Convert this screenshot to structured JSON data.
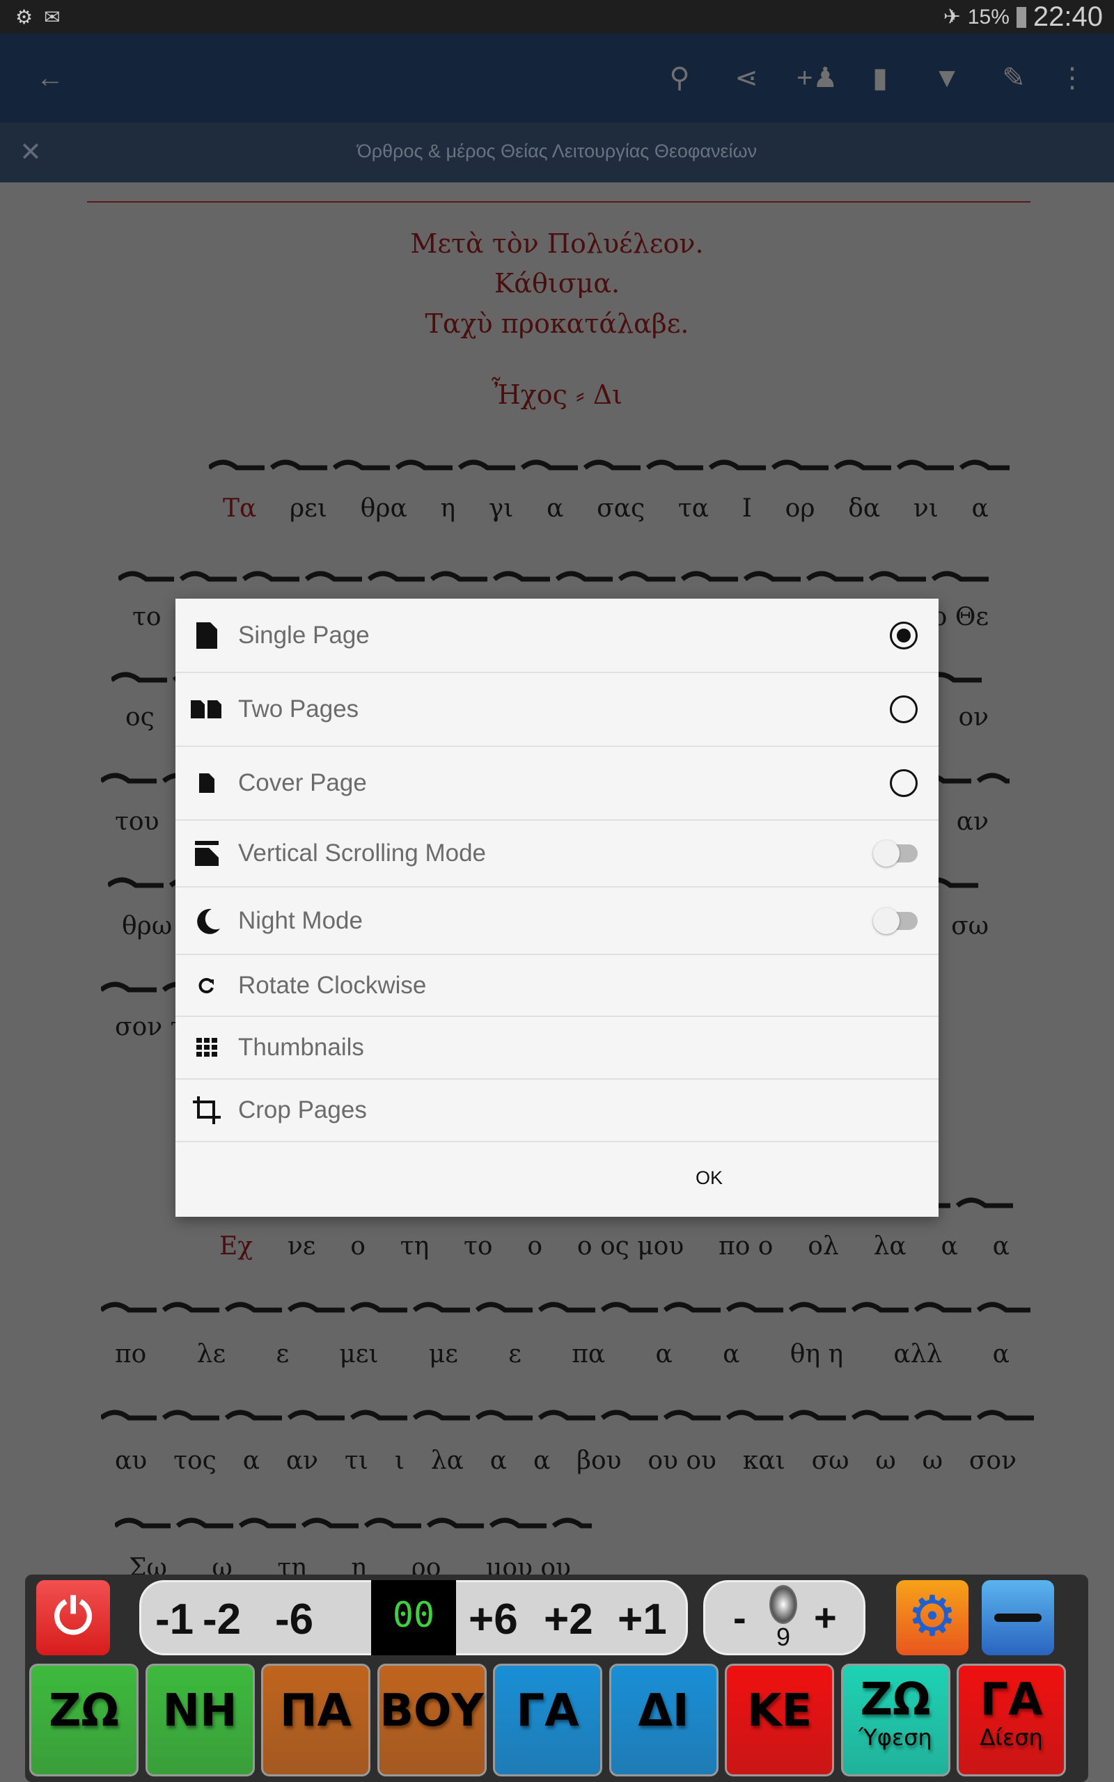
{
  "status_bar": {
    "battery": "15%",
    "time": "22:40",
    "icons": [
      "sd-settings-icon",
      "gmail-icon",
      "airplane-mode-icon",
      "battery-icon"
    ]
  },
  "toolbar": {
    "icons": [
      "back-arrow-icon",
      "search-icon",
      "share-icon",
      "add-person-icon",
      "page-icon",
      "bookmark-icon",
      "edit-icon",
      "more-vert-icon"
    ]
  },
  "subbar": {
    "title": "Όρθρος & μέρος Θείας Λειτουργίας Θεοφανείων"
  },
  "document": {
    "headings": [
      "Μετὰ τὸν Πολυέλεον.",
      "Κάθισμα.",
      "Ταχὺ προκατάλαβε."
    ],
    "echos": "Ἦχος",
    "echos_note": "Δι",
    "lines": [
      [
        "Τα",
        "ρει",
        "θρα",
        "η",
        "γι",
        "α",
        "σας",
        "τα",
        "Ι",
        "ορ",
        "δα",
        "νι",
        "α"
      ],
      [
        "το",
        "ο Θε"
      ],
      [
        "ος",
        "ον"
      ],
      [
        "του",
        "αν"
      ],
      [
        "θρω",
        "σω"
      ],
      [
        "σον τ"
      ],
      [
        "Εχ",
        "νε",
        "ο",
        "τη",
        "το",
        "ο",
        "ο ος μου",
        "πο ο",
        "ολ",
        "λα",
        "α",
        "α"
      ],
      [
        "πο",
        "λε",
        "ε",
        "μει",
        "με",
        "ε",
        "πα",
        "α",
        "α",
        "θη η",
        "αλλ",
        "α"
      ],
      [
        "αυ",
        "τος",
        "α",
        "αν",
        "τι",
        "ι",
        "λα",
        "α",
        "α",
        "βου",
        "ου ου",
        "και",
        "σω",
        "ω",
        "ω",
        "σον"
      ],
      [
        "Σω",
        "ω",
        "τη",
        "η",
        "ρο",
        "μου ου"
      ]
    ]
  },
  "dialog": {
    "items": [
      {
        "label": "Single Page",
        "icon": "single-page-icon",
        "control": "radio",
        "selected": true
      },
      {
        "label": "Two Pages",
        "icon": "two-pages-icon",
        "control": "radio",
        "selected": false
      },
      {
        "label": "Cover Page",
        "icon": "cover-page-icon",
        "control": "radio",
        "selected": false
      },
      {
        "label": "Vertical Scrolling Mode",
        "icon": "vertical-scroll-icon",
        "control": "switch",
        "on": false
      },
      {
        "label": "Night Mode",
        "icon": "moon-icon",
        "control": "switch",
        "on": false
      },
      {
        "label": "Rotate Clockwise",
        "icon": "rotate-cw-icon"
      },
      {
        "label": "Thumbnails",
        "icon": "grid-icon"
      },
      {
        "label": "Crop Pages",
        "icon": "crop-icon"
      }
    ],
    "ok": "OK"
  },
  "panel": {
    "transpose": [
      "-1",
      "-2",
      "-6",
      "00",
      "+6",
      "+2",
      "+1"
    ],
    "volume": {
      "minus": "-",
      "plus": "+",
      "value": "9"
    },
    "keys": [
      {
        "label": "ΖΩ",
        "color": "#3dba3d"
      },
      {
        "label": "ΝΗ",
        "color": "#3dba3d"
      },
      {
        "label": "ΠΑ",
        "color": "#c0641e"
      },
      {
        "label": "ΒΟΥ",
        "color": "#c0641e"
      },
      {
        "label": "ΓΑ",
        "color": "#1a8fd6"
      },
      {
        "label": "ΔΙ",
        "color": "#1a8fd6"
      },
      {
        "label": "ΚΕ",
        "color": "#f01010"
      },
      {
        "label": "ΖΩ",
        "sub": "Ύφεση",
        "color": "#1ed2b4"
      },
      {
        "label": "ΓΑ",
        "sub": "Δίεση",
        "color": "#f01010"
      }
    ]
  }
}
